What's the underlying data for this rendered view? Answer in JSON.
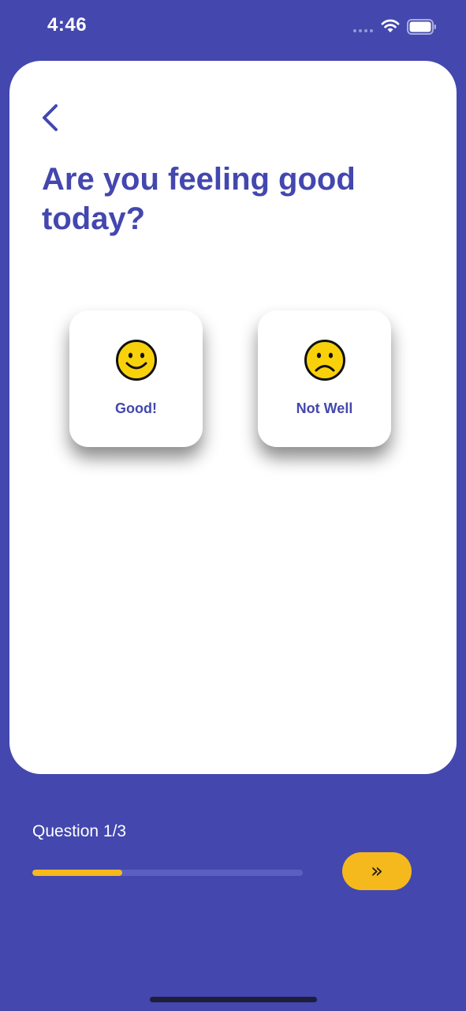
{
  "status_bar": {
    "time": "4:46"
  },
  "screen": {
    "back_icon": "chevron-left-icon",
    "title": "Are you feeling good today?",
    "options": [
      {
        "label": "Good!",
        "icon": "smiley-face-icon"
      },
      {
        "label": "Not Well",
        "icon": "sad-face-icon"
      }
    ]
  },
  "footer": {
    "counter": "Question 1/3",
    "progress": 0.333,
    "next_icon": "double-chevron-right-icon",
    "next_glyph": "»"
  },
  "colors": {
    "background": "#4347AE",
    "card": "#FFFFFF",
    "accent": "#F5B91D",
    "text_primary": "#4347AE",
    "emoji_fill": "#F9D10B"
  }
}
